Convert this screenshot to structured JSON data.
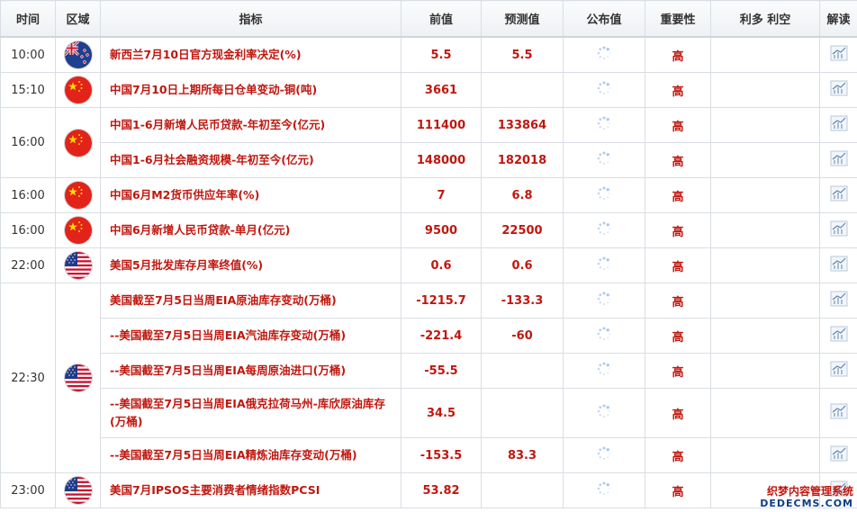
{
  "headers": {
    "time": "时间",
    "region": "区域",
    "indicator": "指标",
    "previous": "前值",
    "forecast": "预测值",
    "actual": "公布值",
    "importance": "重要性",
    "effect": "利多 利空",
    "analysis": "解读"
  },
  "groups": [
    {
      "time": "10:00",
      "flag": "nz",
      "rows": [
        {
          "name": "新西兰7月10日官方现金利率决定(%)",
          "previous": "5.5",
          "forecast": "5.5",
          "importance": "高"
        }
      ]
    },
    {
      "time": "15:10",
      "flag": "cn",
      "rows": [
        {
          "name": "中国7月10日上期所每日仓单变动-铜(吨)",
          "previous": "3661",
          "forecast": "",
          "importance": "高"
        }
      ]
    },
    {
      "time": "16:00",
      "flag": "cn",
      "rows": [
        {
          "name": "中国1-6月新增人民币贷款-年初至今(亿元)",
          "previous": "111400",
          "forecast": "133864",
          "importance": "高"
        },
        {
          "name": "中国1-6月社会融资规模-年初至今(亿元)",
          "previous": "148000",
          "forecast": "182018",
          "importance": "高"
        }
      ]
    },
    {
      "time": "16:00",
      "flag": "cn",
      "rows": [
        {
          "name": "中国6月M2货币供应年率(%)",
          "previous": "7",
          "forecast": "6.8",
          "importance": "高"
        }
      ]
    },
    {
      "time": "16:00",
      "flag": "cn",
      "rows": [
        {
          "name": "中国6月新增人民币贷款-单月(亿元)",
          "previous": "9500",
          "forecast": "22500",
          "importance": "高"
        }
      ]
    },
    {
      "time": "22:00",
      "flag": "us",
      "rows": [
        {
          "name": "美国5月批发库存月率终值(%)",
          "previous": "0.6",
          "forecast": "0.6",
          "importance": "高"
        }
      ]
    },
    {
      "time": "22:30",
      "flag": "us",
      "rows": [
        {
          "name": "美国截至7月5日当周EIA原油库存变动(万桶)",
          "previous": "-1215.7",
          "forecast": "-133.3",
          "importance": "高"
        },
        {
          "name": "--美国截至7月5日当周EIA汽油库存变动(万桶)",
          "previous": "-221.4",
          "forecast": "-60",
          "importance": "高"
        },
        {
          "name": "--美国截至7月5日当周EIA每周原油进口(万桶)",
          "previous": "-55.5",
          "forecast": "",
          "importance": "高"
        },
        {
          "name": "--美国截至7月5日当周EIA俄克拉荷马州-库欣原油库存(万桶)",
          "previous": "34.5",
          "forecast": "",
          "importance": "高",
          "tall": true
        },
        {
          "name": "--美国截至7月5日当周EIA精炼油库存变动(万桶)",
          "previous": "-153.5",
          "forecast": "83.3",
          "importance": "高"
        }
      ]
    },
    {
      "time": "23:00",
      "flag": "us",
      "rows": [
        {
          "name": "美国7月IPSOS主要消费者情绪指数PCSI",
          "previous": "53.82",
          "forecast": "",
          "importance": "高"
        }
      ]
    }
  ],
  "icons": {
    "actual": "loading-spinner-icon",
    "analysis": "line-chart-icon"
  },
  "colors": {
    "accent": "#c0170f",
    "border": "#d9dee4",
    "header_bg": "#eef1f4"
  },
  "watermark": {
    "line1": "织梦内容管理系统",
    "line2": "DEDECMS.COM"
  }
}
